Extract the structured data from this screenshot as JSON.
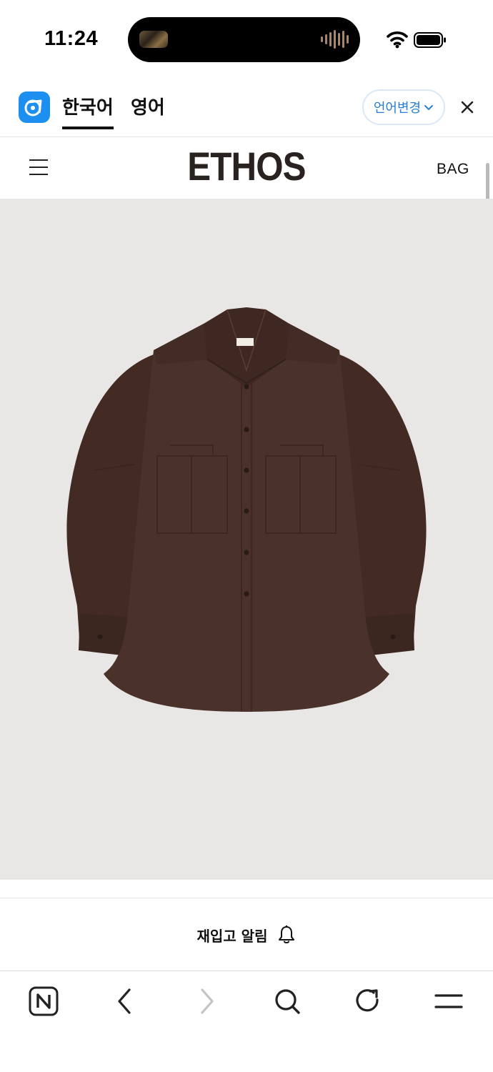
{
  "status_bar": {
    "time": "11:24",
    "icons": [
      "now-playing-artwork",
      "audio-waveform-icon",
      "wifi-icon",
      "battery-icon"
    ]
  },
  "translate_bar": {
    "app_icon": "papago-icon",
    "tabs": [
      {
        "label": "한국어",
        "active": true
      },
      {
        "label": "영어",
        "active": false
      }
    ],
    "change_language_label": "언어변경",
    "close_icon": "close-icon"
  },
  "site_header": {
    "menu_icon": "hamburger-menu-icon",
    "logo": "ETHOS",
    "bag_label": "BAG"
  },
  "product": {
    "image": "brown oversized button-down shirt",
    "background_color": "#e9e7e5",
    "shirt_color": "#4a3129"
  },
  "restock": {
    "label": "재입고 알림",
    "icon": "bell-icon"
  },
  "browser_toolbar": {
    "items": [
      "naver-home-icon",
      "back-icon",
      "forward-icon",
      "search-icon",
      "refresh-icon",
      "menu-icon"
    ],
    "forward_disabled": true
  },
  "colors": {
    "accent_blue": "#1d8ff0",
    "link_blue": "#2a7fd4",
    "text": "#111111"
  }
}
